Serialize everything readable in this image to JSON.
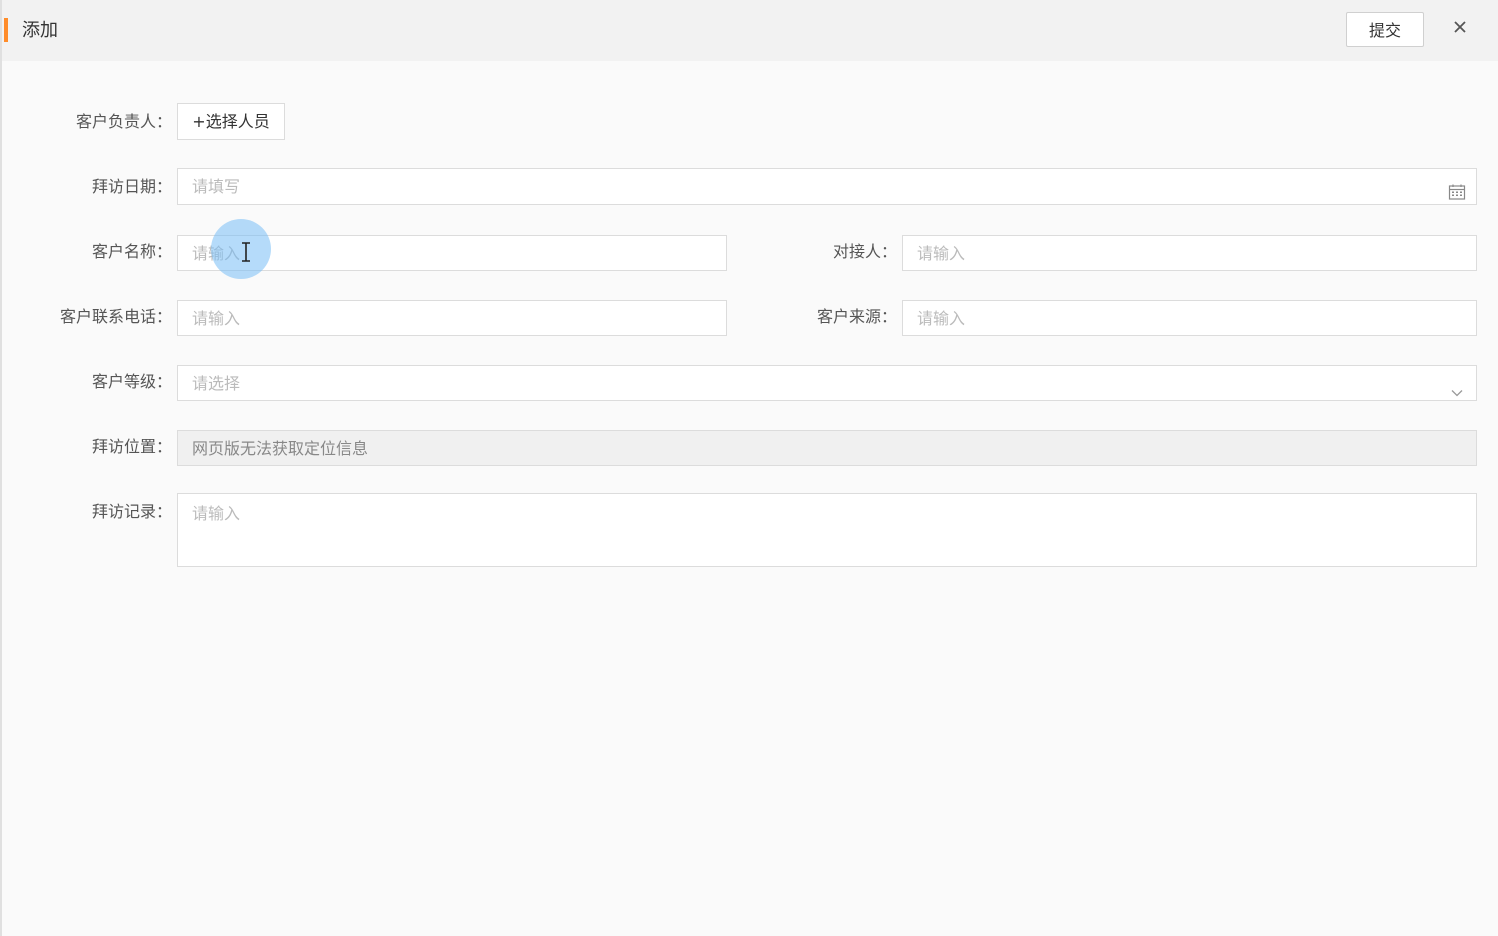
{
  "header": {
    "title": "添加",
    "submit_label": "提交",
    "close_icon": "close-icon",
    "accent_color": "#ff8c2a"
  },
  "form": {
    "owner": {
      "label": "客户负责人：",
      "button_label": "+选择人员"
    },
    "visit_date": {
      "label": "拜访日期：",
      "placeholder": "请填写",
      "icon": "calendar-icon"
    },
    "customer_name": {
      "label": "客户名称：",
      "placeholder": "请输入"
    },
    "contact_person": {
      "label": "对接人：",
      "placeholder": "请输入"
    },
    "customer_phone": {
      "label": "客户联系电话：",
      "placeholder": "请输入"
    },
    "customer_source": {
      "label": "客户来源：",
      "placeholder": "请输入"
    },
    "customer_level": {
      "label": "客户等级：",
      "placeholder": "请选择",
      "icon": "chevron-down-icon"
    },
    "visit_location": {
      "label": "拜访位置：",
      "value": "网页版无法获取定位信息"
    },
    "visit_record": {
      "label": "拜访记录：",
      "placeholder": "请输入"
    }
  }
}
